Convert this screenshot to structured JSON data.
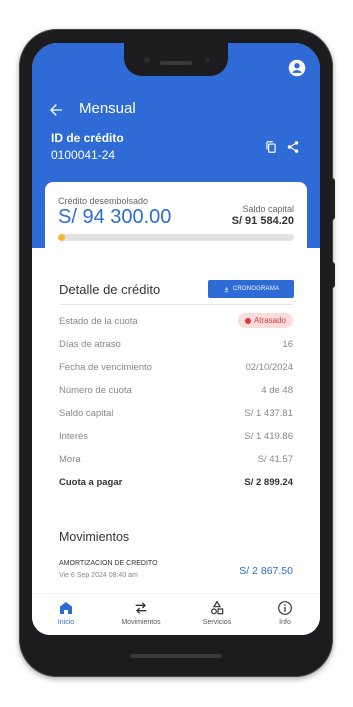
{
  "header": {
    "title": "Mensual",
    "credit_label": "ID de crédito",
    "credit_id": "0100041-24"
  },
  "summary": {
    "disbursed_label": "Crédito desembolsado",
    "disbursed_value": "S/ 94 300.00",
    "balance_label": "Saldo capital",
    "balance_value": "S/ 91 584.20",
    "progress_fraction": 0.03
  },
  "detail": {
    "title": "Detalle de crédito",
    "schedule_button": "CRONOGRAMA",
    "rows": [
      {
        "label": "Estado de la cuota",
        "value": "Atrasado"
      },
      {
        "label": "Días de atraso",
        "value": "16"
      },
      {
        "label": "Fecha de vencimiento",
        "value": "02/10/2024"
      },
      {
        "label": "Número de cuota",
        "value": "4 de 48"
      },
      {
        "label": "Saldo capital",
        "value": "S/ 1 437.81"
      },
      {
        "label": "Interés",
        "value": "S/ 1 419.86"
      },
      {
        "label": "Mora",
        "value": "S/ 41.57"
      },
      {
        "label": "Cuota a pagar",
        "value": "S/ 2 899.24"
      }
    ]
  },
  "movements": {
    "title": "Movimientos",
    "items": [
      {
        "title": "AMORTIZACION DE CREDITO",
        "date": "Vie 6 Sep 2024 08:40 am",
        "amount": "S/ 2 867.50"
      }
    ]
  },
  "nav": {
    "items": [
      {
        "label": "Inicio",
        "icon": "home-icon"
      },
      {
        "label": "Movimientos",
        "icon": "swap-arrows-icon"
      },
      {
        "label": "Servicios",
        "icon": "shapes-icon"
      },
      {
        "label": "Info",
        "icon": "info-icon"
      }
    ]
  },
  "colors": {
    "primary": "#2e6bd6",
    "progress": "#f2b632",
    "status_bg": "#fbdcdc",
    "status_text": "#d83a3a"
  }
}
